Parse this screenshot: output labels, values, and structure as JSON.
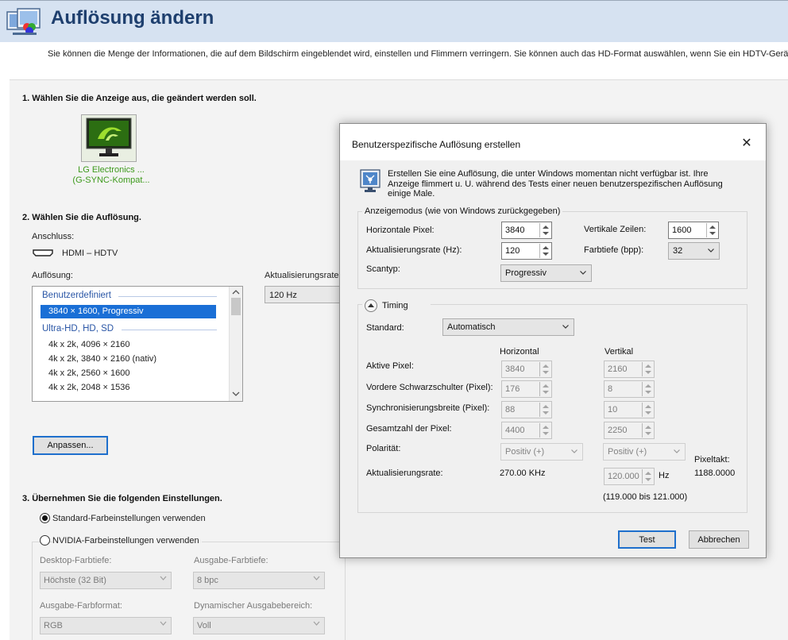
{
  "header": {
    "title": "Auflösung ändern",
    "intro": "Sie können die Menge der Informationen, die auf dem Bildschirm eingeblendet wird, einstellen und Flimmern verringern. Sie können auch das HD-Format auswählen, wenn Sie ein HDTV-Gerät verwe"
  },
  "section1": {
    "title": "1. Wählen Sie die Anzeige aus, die geändert werden soll.",
    "display_name_1": "LG Electronics ...",
    "display_name_2": "(G-SYNC-Kompat..."
  },
  "section2": {
    "title": "2. Wählen Sie die Auflösung.",
    "connection_label": "Anschluss:",
    "connection_value": "HDMI – HDTV",
    "resolution_label": "Auflösung:",
    "refresh_label": "Aktualisierungsrate:",
    "refresh_value": "120 Hz",
    "group_custom": "Benutzerdefiniert",
    "selected_item": "3840 × 1600, Progressiv",
    "group_uhd": "Ultra-HD, HD, SD",
    "items": [
      "4k x 2k, 4096 × 2160",
      "4k x 2k, 3840 × 2160 (nativ)",
      "4k x 2k, 2560 × 1600",
      "4k x 2k, 2048 × 1536"
    ],
    "customize_button": "Anpassen..."
  },
  "section3": {
    "title": "3. Übernehmen Sie die folgenden Einstellungen.",
    "radio_default": "Standard-Farbeinstellungen verwenden",
    "radio_nvidia": "NVIDIA-Farbeinstellungen verwenden",
    "desktop_depth_label": "Desktop-Farbtiefe:",
    "desktop_depth_value": "Höchste (32 Bit)",
    "output_depth_label": "Ausgabe-Farbtiefe:",
    "output_depth_value": "8 bpc",
    "output_format_label": "Ausgabe-Farbformat:",
    "output_format_value": "RGB",
    "dynamic_range_label": "Dynamischer Ausgabebereich:",
    "dynamic_range_value": "Voll"
  },
  "dialog": {
    "title": "Benutzerspezifische Auflösung erstellen",
    "close_glyph": "✕",
    "info_line1": "Erstellen Sie eine Auflösung, die unter Windows momentan nicht verfügbar ist. Ihre",
    "info_line2": "Anzeige flimmert u. U. während des Tests einer neuen benutzerspezifischen Auflösung",
    "info_line3": "einige Male.",
    "display_mode_legend": "Anzeigemodus (wie von Windows zurückgegeben)",
    "h_pixels_label": "Horizontale Pixel:",
    "h_pixels_value": "3840",
    "v_lines_label": "Vertikale Zeilen:",
    "v_lines_value": "1600",
    "refresh_label": "Aktualisierungsrate (Hz):",
    "refresh_value": "120",
    "color_depth_label": "Farbtiefe (bpp):",
    "color_depth_value": "32",
    "scan_type_label": "Scantyp:",
    "scan_type_value": "Progressiv",
    "timing_legend": "Timing",
    "standard_label": "Standard:",
    "standard_value": "Automatisch",
    "col_horizontal": "Horizontal",
    "col_vertical": "Vertikal",
    "active_pixels_label": "Aktive Pixel:",
    "active_pixels_h": "3840",
    "active_pixels_v": "2160",
    "front_porch_label": "Vordere Schwarzschulter (Pixel):",
    "front_porch_h": "176",
    "front_porch_v": "8",
    "sync_width_label": "Synchronisierungsbreite (Pixel):",
    "sync_width_h": "88",
    "sync_width_v": "10",
    "total_pixels_label": "Gesamtzahl der Pixel:",
    "total_pixels_h": "4400",
    "total_pixels_v": "2250",
    "polarity_label": "Polarität:",
    "polarity_h": "Positiv (+)",
    "polarity_v": "Positiv (+)",
    "pixel_clock_label": "Pixeltakt:",
    "pixel_clock_value": "1188.0000",
    "timing_refresh_label": "Aktualisierungsrate:",
    "timing_refresh_h": "270.00 KHz",
    "timing_refresh_v": "120.000",
    "hz_unit": "Hz",
    "range_text": "(119.000 bis 121.000)",
    "test_button": "Test",
    "cancel_button": "Abbrechen"
  },
  "colors": {
    "header_bg": "#d6e2f1",
    "title_blue": "#1e3f6e",
    "selection": "#1a6fd6",
    "nvidia_green": "#76b900",
    "focus_border": "#1e6fcc"
  }
}
